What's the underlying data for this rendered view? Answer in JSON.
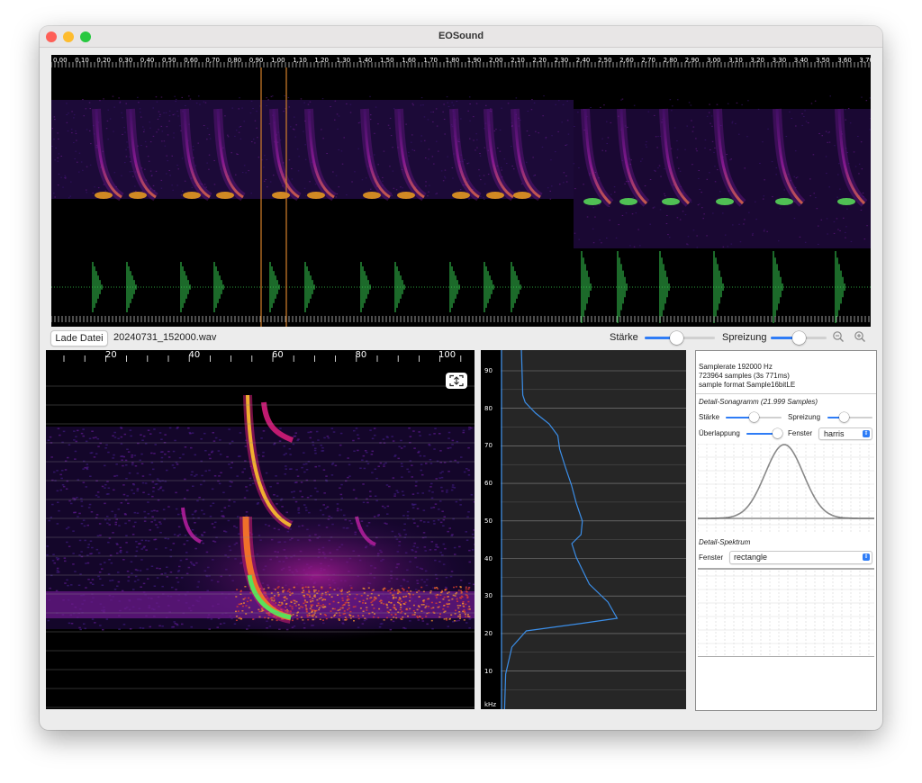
{
  "window": {
    "title": "EOSound"
  },
  "overview": {
    "time_ticks": [
      "0,00",
      "0,10",
      "0,20",
      "0,30",
      "0,40",
      "0,50",
      "0,60",
      "0,70",
      "0,80",
      "0,90",
      "1,00",
      "1,10",
      "1,20",
      "1,30",
      "1,40",
      "1,50",
      "1,60",
      "1,70",
      "1,80",
      "1,90",
      "2,00",
      "2,10",
      "2,20",
      "2,30",
      "2,40",
      "2,50",
      "2,60",
      "2,70",
      "2,80",
      "2,90",
      "3,00",
      "3,10",
      "3,20",
      "3,30",
      "3,40",
      "3,50",
      "3,60",
      "3,70"
    ],
    "selection_color": "#d4802a"
  },
  "controls": {
    "load_button": "Lade Datei",
    "filename": "20240731_152000.wav",
    "strength_label": "Stärke",
    "strength_value": 0.45,
    "spread_label": "Spreizung",
    "spread_value": 0.5,
    "zoom_out_icon": "zoom-out-icon",
    "zoom_in_icon": "zoom-in-icon"
  },
  "detail": {
    "x_ticks": [
      "20",
      "40",
      "60",
      "80",
      "100"
    ],
    "fit_icon": "fit-screen-icon"
  },
  "spectrum": {
    "y_ticks": [
      "90",
      "80",
      "70",
      "60",
      "50",
      "40",
      "30",
      "20",
      "10"
    ],
    "unit": "kHz"
  },
  "info": {
    "samplerate": "Samplerate 192000 Hz",
    "samples": "723964 samples (3s 771ms)",
    "format": "sample format Sample16bitLE",
    "detail_sonagram_title": "Detail-Sonagramm (21.999 Samples)",
    "strength_label": "Stärke",
    "strength_value": 0.5,
    "spread_label": "Spreizung",
    "spread_value": 0.35,
    "overlap_label": "Überlappung",
    "overlap_value": 0.9,
    "window_label": "Fenster",
    "window_value": "harris",
    "detail_spectrum_title": "Detail-Spektrum",
    "spectrum_window_label": "Fenster",
    "spectrum_window_value": "rectangle"
  },
  "colors": {
    "accent": "#2e7cf6",
    "spectrum_line": "#3b8ee8",
    "window_curve": "#888888",
    "waveform": "#39d353"
  }
}
